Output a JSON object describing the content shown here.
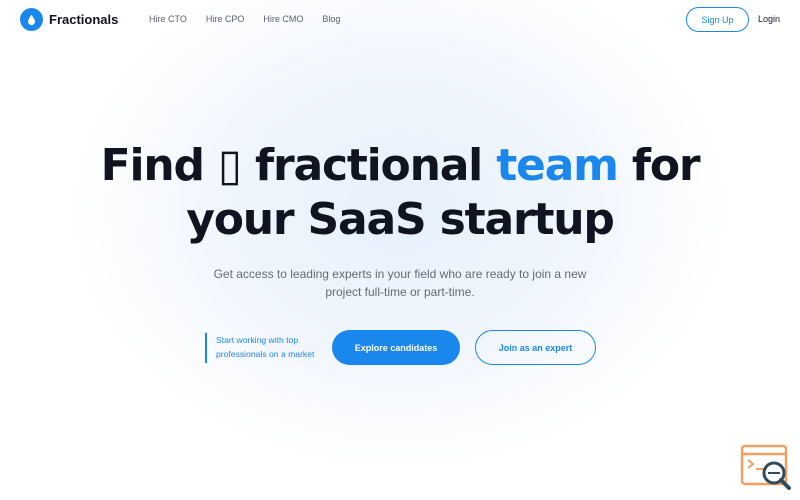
{
  "brand": {
    "name": "Fractionals",
    "logo_icon": "drop-icon",
    "accent_color": "#1a87ec"
  },
  "nav": {
    "links": [
      {
        "label": "Hire CTO"
      },
      {
        "label": "Hire CPO"
      },
      {
        "label": "Hire CMO"
      },
      {
        "label": "Blog"
      }
    ],
    "signup_label": "Sign Up",
    "login_label": "Login"
  },
  "hero": {
    "headline_line1_part1": "Find ",
    "headline_glyph": "▯",
    "headline_line1_part2": " fractional ",
    "headline_accent": "team",
    "headline_line1_part3": " for",
    "headline_line2": "your SaaS startup",
    "subtitle": "Get access to leading experts in your field who are ready to join a new project full-time or part-time.",
    "cta_note": "Start working with top professionals on a market",
    "primary_cta": "Explore candidates",
    "secondary_cta": "Join as an expert"
  },
  "widget": {
    "icon": "search-code-icon"
  }
}
